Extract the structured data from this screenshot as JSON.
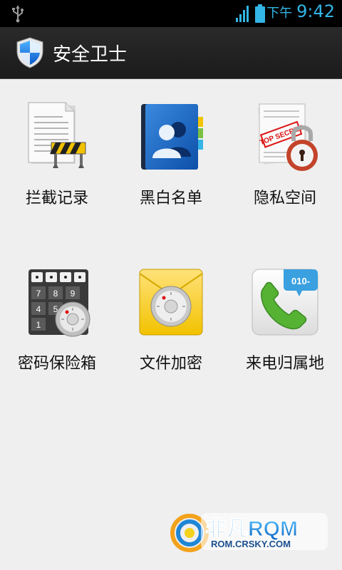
{
  "status_bar": {
    "ampm": "下午",
    "time": "9:42"
  },
  "action_bar": {
    "title": "安全卫士",
    "icon": "shield-icon"
  },
  "grid": {
    "items": [
      {
        "label": "拦截记录",
        "icon": "document-barrier-icon"
      },
      {
        "label": "黑白名单",
        "icon": "contacts-book-icon"
      },
      {
        "label": "隐私空间",
        "icon": "top-secret-lock-icon"
      },
      {
        "label": "密码保险箱",
        "icon": "keypad-safe-icon"
      },
      {
        "label": "文件加密",
        "icon": "envelope-dial-icon"
      },
      {
        "label": "来电归属地",
        "icon": "phone-area-code-icon"
      }
    ]
  },
  "keypad": {
    "keys": [
      "7",
      "8",
      "9",
      "4",
      "5",
      "1"
    ]
  },
  "area_code": "010-",
  "top_secret": "TOP SECRET",
  "watermark": {
    "brand": "非凡RQM",
    "site": "ROM.CRSKY.COM"
  },
  "colors": {
    "status_accent": "#33b5e5",
    "action_bar_bg": "#1f1f1f",
    "content_bg": "#efefef"
  }
}
